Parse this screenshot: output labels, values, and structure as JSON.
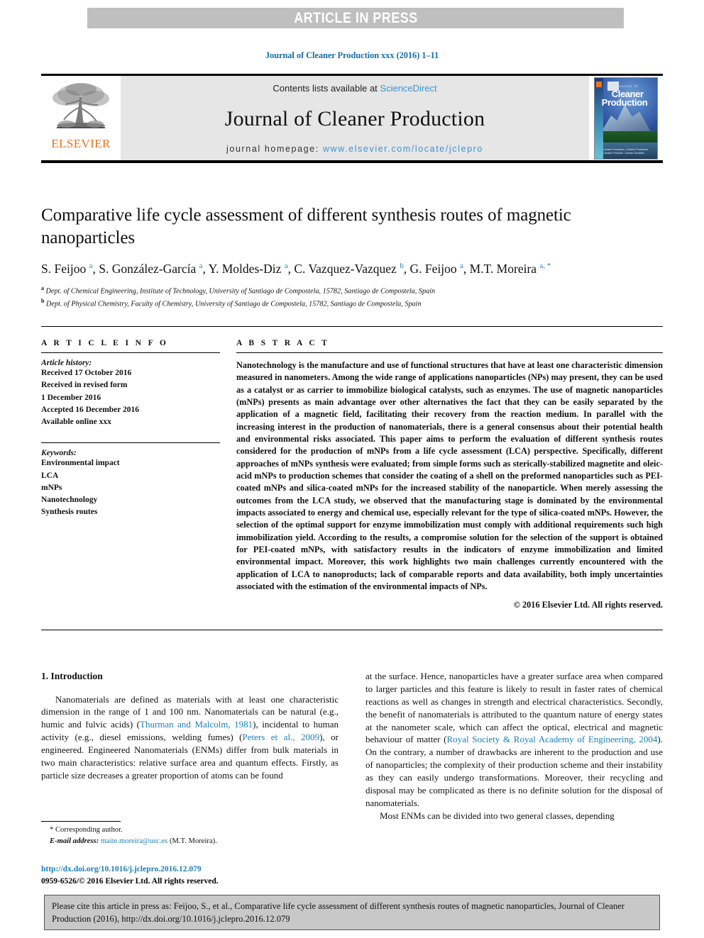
{
  "banner": {
    "text": "ARTICLE IN PRESS",
    "background_color": "#bfbfbf",
    "text_color": "#ffffff"
  },
  "journal_ref": "Journal of Cleaner Production xxx (2016) 1–11",
  "masthead": {
    "publisher": "ELSEVIER",
    "contents_prefix": "Contents lists available at ",
    "contents_link": "ScienceDirect",
    "journal_title": "Journal of Cleaner Production",
    "homepage_label": "journal homepage: ",
    "homepage_url": "www.elsevier.com/locate/jclepro",
    "link_color": "#3a95d3",
    "cover": {
      "line1": "Journal of",
      "line2": "Cleaner",
      "line3": "Production",
      "footer_note": "Cleaner Processes  •  Cleaner Production\nCleaner Products  •  Cleaner Societies"
    }
  },
  "article": {
    "title": "Comparative life cycle assessment of different synthesis routes of magnetic nanoparticles",
    "authors_html": "S. Feijoo <sup>a</sup>, S. González-García <sup>a</sup>, Y. Moldes-Diz <sup>a</sup>, C. Vazquez-Vazquez <sup>b</sup>, G. Feijoo <sup>a</sup>, M.T. Moreira <sup>a, *</sup>",
    "affiliation_a": "Dept. of Chemical Engineering, Institute of Technology, University of Santiago de Compostela, 15782, Santiago de Compostela, Spain",
    "affiliation_b": "Dept. of Physical Chemistry, Faculty of Chemistry, University of Santiago de Compostela, 15782, Santiago de Compostela, Spain",
    "affiliation_a_marker": "a",
    "affiliation_b_marker": "b"
  },
  "article_info": {
    "heading": "A R T I C L E  I N F O",
    "history_label": "Article history:",
    "history": [
      "Received 17 October 2016",
      "Received in revised form",
      "1 December 2016",
      "Accepted 16 December 2016",
      "Available online xxx"
    ],
    "keywords_label": "Keywords:",
    "keywords": [
      "Environmental impact",
      "LCA",
      "mNPs",
      "Nanotechnology",
      "Synthesis routes"
    ]
  },
  "abstract": {
    "heading": "A B S T R A C T",
    "text": "Nanotechnology is the manufacture and use of functional structures that have at least one characteristic dimension measured in nanometers. Among the wide range of applications nanoparticles (NPs) may present, they can be used as a catalyst or as carrier to immobilize biological catalysts, such as enzymes. The use of magnetic nanoparticles (mNPs) presents as main advantage over other alternatives the fact that they can be easily separated by the application of a magnetic field, facilitating their recovery from the reaction medium. In parallel with the increasing interest in the production of nanomaterials, there is a general consensus about their potential health and environmental risks associated. This paper aims to perform the evaluation of different synthesis routes considered for the production of mNPs from a life cycle assessment (LCA) perspective. Specifically, different approaches of mNPs synthesis were evaluated; from simple forms such as sterically-stabilized magnetite and oleic-acid mNPs to production schemes that consider the coating of a shell on the preformed nanoparticles such as PEI-coated mNPs and silica-coated mNPs for the increased stability of the nanoparticle. When merely assessing the outcomes from the LCA study, we observed that the manufacturing stage is dominated by the environmental impacts associated to energy and chemical use, especially relevant for the type of silica-coated mNPs. However, the selection of the optimal support for enzyme immobilization must comply with additional requirements such high immobilization yield. According to the results, a compromise solution for the selection of the support is obtained for PEI-coated mNPs, with satisfactory results in the indicators of enzyme immobilization and limited environmental impact. Moreover, this work highlights two main challenges currently encountered with the application of LCA to nanoproducts; lack of comparable reports and data availability, both imply uncertainties associated with the estimation of the environmental impacts of NPs.",
    "copyright": "© 2016 Elsevier Ltd. All rights reserved."
  },
  "body": {
    "section_number_title": "1. Introduction",
    "left_paragraph_html": "Nanomaterials are defined as materials with at least one characteristic dimension in the range of 1 and 100 nm. Nanomaterials can be natural (e.g., humic and fulvic acids) (<span class=\"cite\">Thurman and Malcolm, 1981</span>), incidental to human activity (e.g., diesel emissions, welding fumes) (<span class=\"cite\">Peters et al., 2009</span>), or engineered. Engineered Nanomaterials (ENMs) differ from bulk materials in two main characteristics: relative surface area and quantum effects. Firstly, as particle size decreases a greater proportion of atoms can be found",
    "right_paragraph_1_html": "at the surface. Hence, nanoparticles have a greater surface area when compared to larger particles and this feature is likely to result in faster rates of chemical reactions as well as changes in strength and electrical characteristics. Secondly, the benefit of nanomaterials is attributed to the quantum nature of energy states at the nanometer scale, which can affect the optical, electrical and magnetic behaviour of matter (<span class=\"cite\">Royal Society &amp; Royal Academy of Engineering, 2004</span>). On the contrary, a number of drawbacks are inherent to the production and use of nanoparticles; the complexity of their production scheme and their instability as they can easily undergo transformations. Moreover, their recycling and disposal may be complicated as there is no definite solution for the disposal of nanomaterials.",
    "right_paragraph_2": "Most ENMs can be divided into two general classes, depending"
  },
  "footnote": {
    "corresponding": "* Corresponding author.",
    "email_label": "E-mail address: ",
    "email": "maite.moreira@usc.es",
    "email_suffix": " (M.T. Moreira).",
    "doi_url": "http://dx.doi.org/10.1016/j.jclepro.2016.12.079",
    "issn_line": "0959-6526/© 2016 Elsevier Ltd. All rights reserved."
  },
  "citation_box": {
    "text": "Please cite this article in press as: Feijoo, S., et al., Comparative life cycle assessment of different synthesis routes of magnetic nanoparticles, Journal of Cleaner Production (2016), http://dx.doi.org/10.1016/j.jclepro.2016.12.079",
    "background_color": "#c8c8c8"
  }
}
